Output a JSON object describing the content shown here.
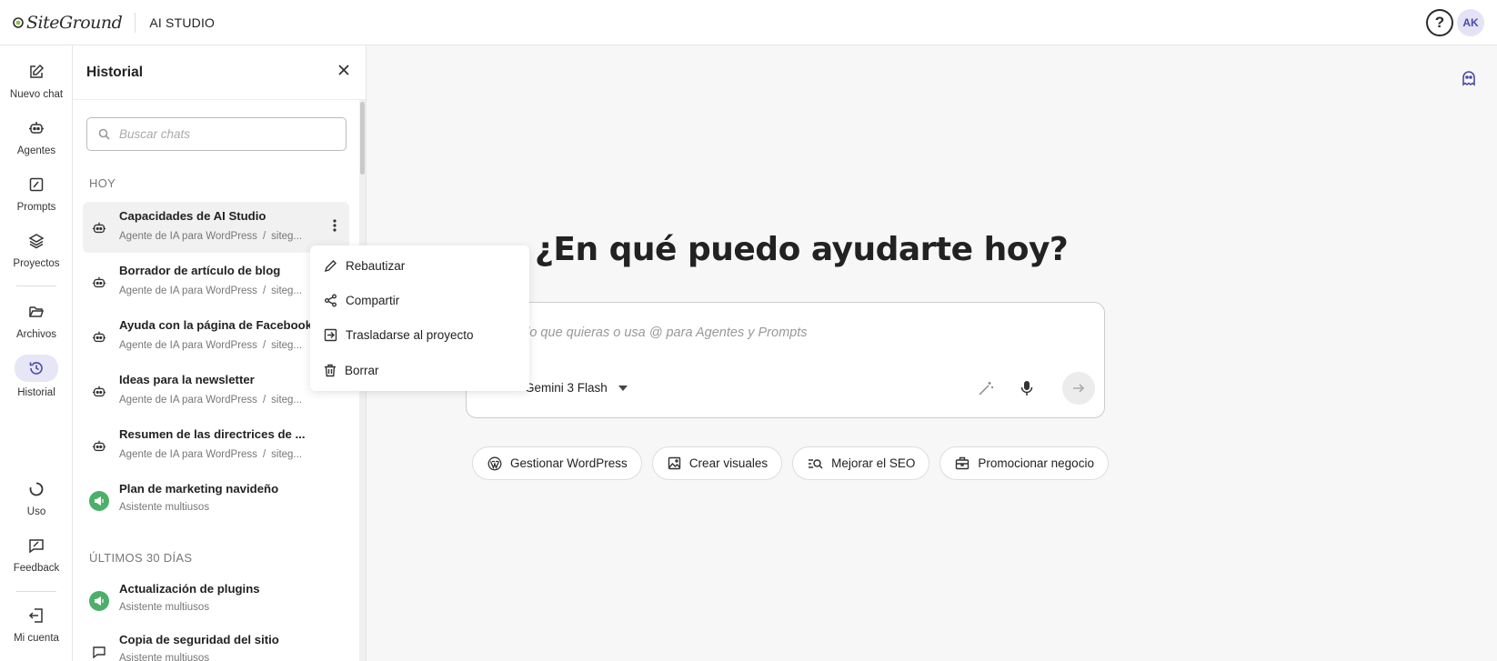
{
  "app": {
    "logo_text": "SiteGround",
    "title": "AI STUDIO",
    "help_label": "?",
    "avatar_initials": "AK"
  },
  "rail": {
    "items": [
      {
        "label": "Nuevo chat",
        "icon": "edit-icon"
      },
      {
        "label": "Agentes",
        "icon": "robot-icon"
      },
      {
        "label": "Prompts",
        "icon": "prompt-icon"
      },
      {
        "label": "Proyectos",
        "icon": "layers-icon"
      },
      {
        "label": "Archivos",
        "icon": "folder-open-icon"
      },
      {
        "label": "Historial",
        "icon": "history-icon",
        "active": true
      },
      {
        "label": "Uso",
        "icon": "usage-icon"
      },
      {
        "label": "Feedback",
        "icon": "feedback-icon"
      },
      {
        "label": "Mi cuenta",
        "icon": "logout-icon"
      }
    ]
  },
  "history": {
    "title": "Historial",
    "search_placeholder": "Buscar chats",
    "sections": [
      {
        "label": "HOY",
        "items": [
          {
            "title": "Capacidades de AI Studio",
            "agent": "Agente de IA para WordPress",
            "site": "siteg...",
            "icon": "robot-icon",
            "selected": true
          },
          {
            "title": "Borrador de artículo de blog",
            "agent": "Agente de IA para WordPress",
            "site": "siteg...",
            "icon": "robot-icon"
          },
          {
            "title": "Ayuda con la página de Facebook",
            "agent": "Agente de IA para WordPress",
            "site": "siteg...",
            "icon": "robot-icon"
          },
          {
            "title": "Ideas para la newsletter",
            "agent": "Agente de IA para WordPress",
            "site": "siteg...",
            "icon": "robot-icon"
          },
          {
            "title": "Resumen de las directrices de ...",
            "agent": "Agente de IA para WordPress",
            "site": "siteg...",
            "icon": "robot-icon"
          },
          {
            "title": "Plan de marketing navideño",
            "agent": "Asistente multiusos",
            "icon": "megaphone-icon"
          }
        ]
      },
      {
        "label": "ÚLTIMOS 30 DÍAS",
        "items": [
          {
            "title": "Actualización de plugins",
            "agent": "Asistente multiusos",
            "icon": "megaphone-icon"
          },
          {
            "title": "Copia de seguridad del sitio",
            "agent": "Asistente multiusos",
            "icon": "chat-bubble-icon"
          }
        ]
      }
    ]
  },
  "context_menu": {
    "items": [
      {
        "label": "Rebautizar",
        "icon": "pencil-icon"
      },
      {
        "label": "Compartir",
        "icon": "share-icon"
      },
      {
        "label": "Trasladarse al proyecto",
        "icon": "move-to-project-icon"
      },
      {
        "label": "Borrar",
        "icon": "trash-icon"
      }
    ]
  },
  "main": {
    "heading": "¿En qué puedo ayudarte hoy?",
    "composer_placeholder": "ta lo que quieras o usa @ para Agentes y Prompts",
    "model": "Gemini 3 Flash",
    "chips": [
      {
        "label": "Gestionar WordPress",
        "icon": "wordpress-icon"
      },
      {
        "label": "Crear visuales",
        "icon": "image-icon"
      },
      {
        "label": "Mejorar el SEO",
        "icon": "seo-search-icon"
      },
      {
        "label": "Promocionar negocio",
        "icon": "briefcase-icon"
      }
    ]
  },
  "colors": {
    "accent": "#4a4aa8",
    "active_bg": "#e6e6f6",
    "green_badge": "#4caf6a"
  }
}
